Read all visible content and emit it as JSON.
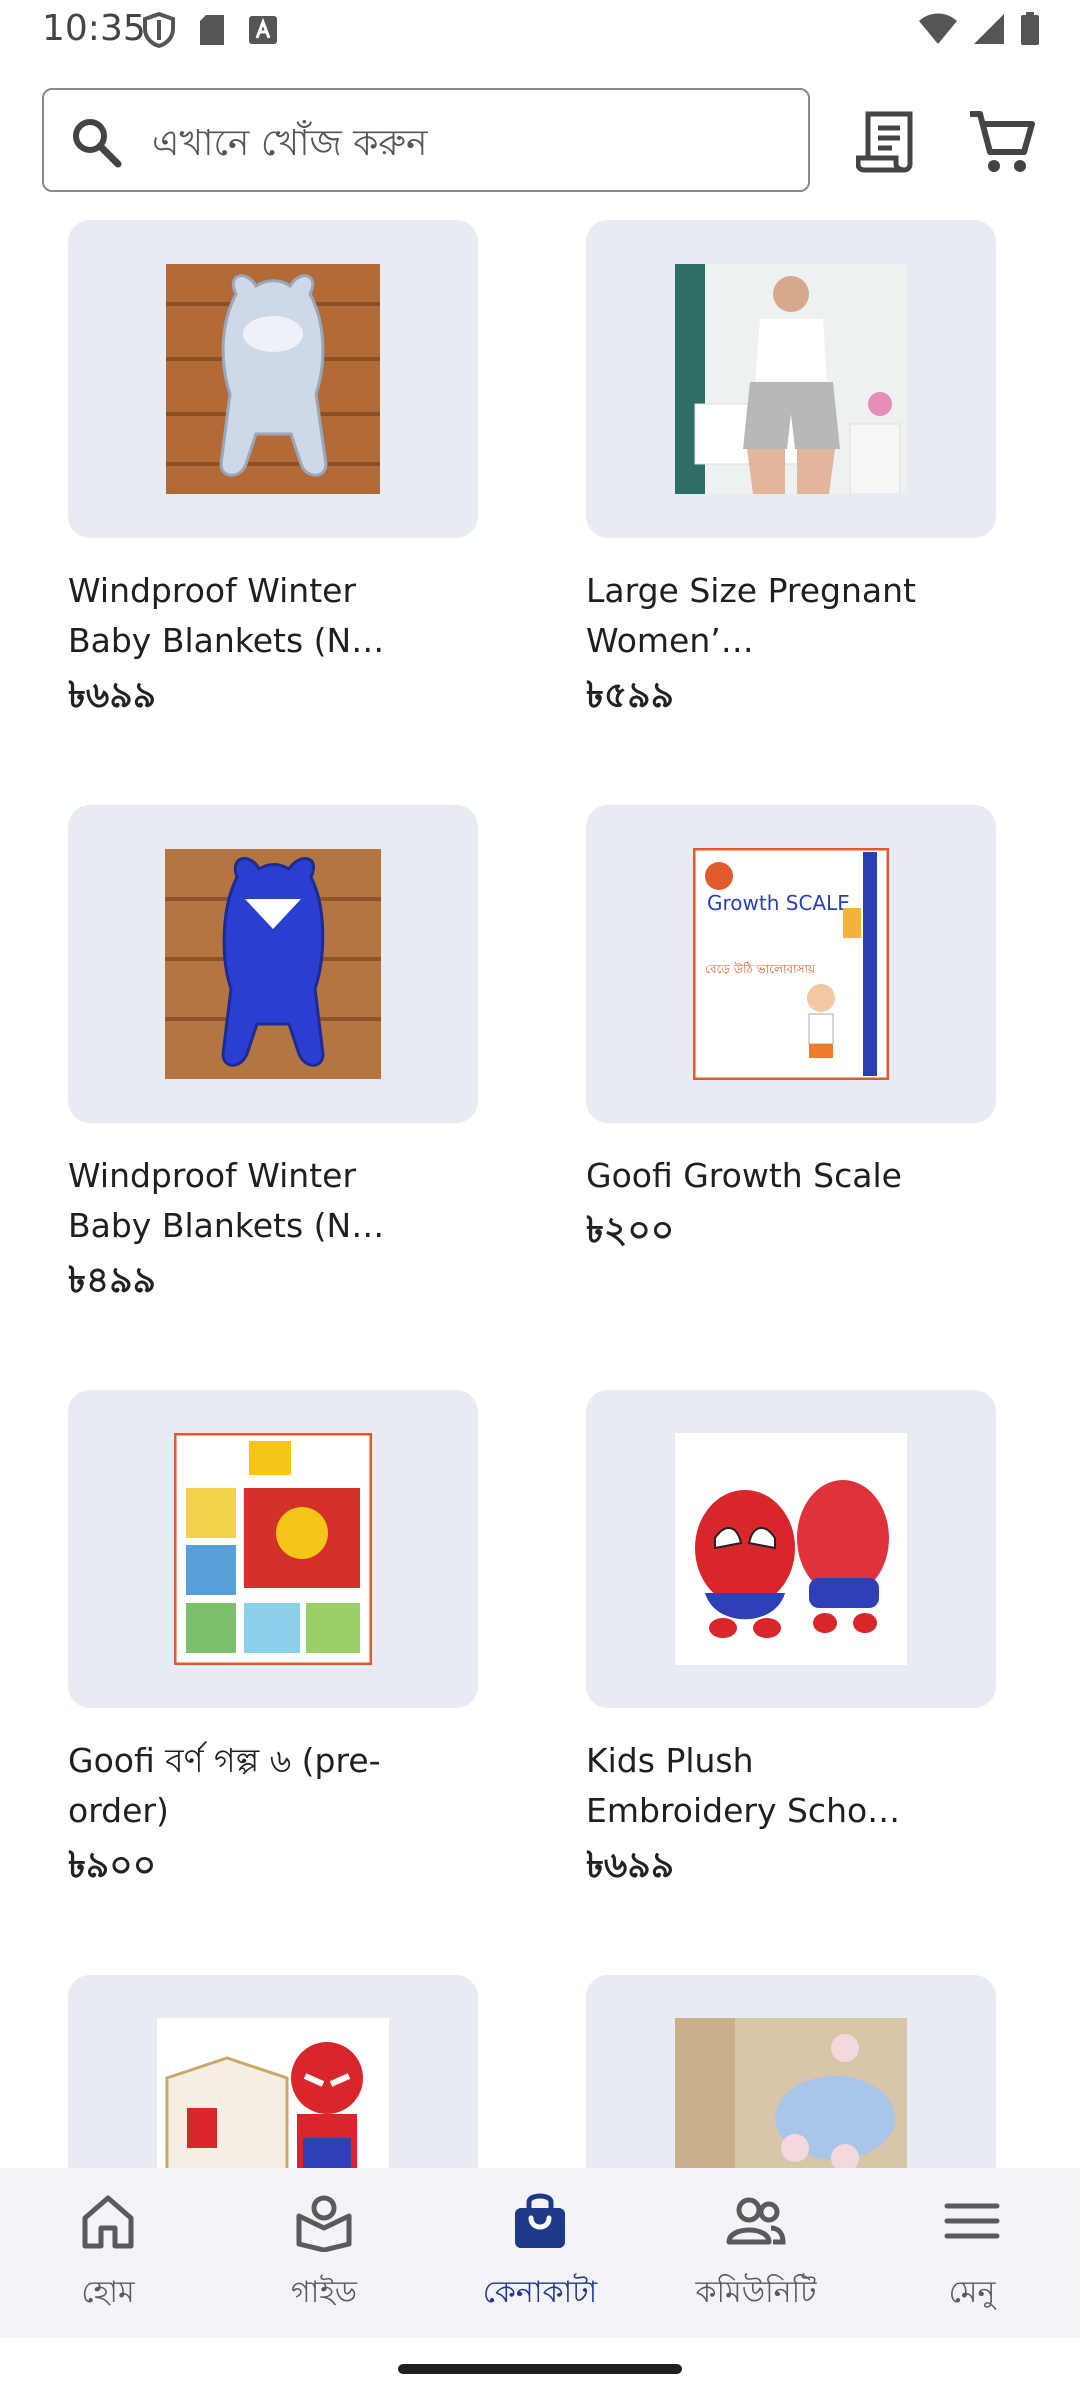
{
  "status_bar": {
    "time": "10:35"
  },
  "search": {
    "placeholder": "এখানে খোঁজ করুন"
  },
  "products": [
    {
      "title": "Windproof Winter Baby Blankets (N…",
      "price": "৳৬৯৯",
      "image": "grey-baby-blanket"
    },
    {
      "title": "Large Size Pregnant Women’…",
      "price": "৳৫৯৯",
      "image": "maternity-shorts-photo"
    },
    {
      "title": "Windproof Winter Baby Blankets (N…",
      "price": "৳৪৯৯",
      "image": "blue-baby-blanket"
    },
    {
      "title": "Goofi Growth Scale",
      "price": "৳২০০",
      "image": "growth-scale-chart"
    },
    {
      "title": "Goofi বর্ণ গল্প ৬ (pre-order)",
      "price": "৳৯০০",
      "image": "book-set-cover"
    },
    {
      "title": "Kids Plush Embroidery Scho…",
      "price": "৳৬৯৯",
      "image": "spiderman-backpack"
    },
    {
      "title": "",
      "price": "",
      "image": "spiderman-block-toy"
    },
    {
      "title": "",
      "price": "",
      "image": "whale-toy"
    }
  ],
  "partial_images": {
    "growth_scale_text": "Growth SCALE",
    "growth_scale_bn": "বেড়ে উঠি ভালোবাসায়"
  },
  "nav": {
    "home": "হোম",
    "guide": "গাইড",
    "shop": "কেনাকাটা",
    "community": "কমিউনিটি",
    "menu": "মেনু"
  },
  "colors": {
    "accent": "#1d3a8a",
    "card_bg": "#e8ebf2",
    "nav_bg": "#f4f3f9"
  }
}
